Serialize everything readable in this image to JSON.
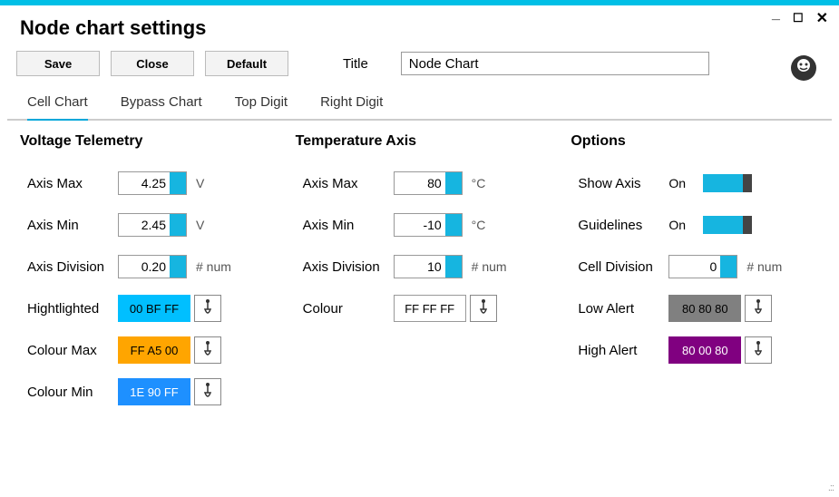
{
  "window_title": "Node chart settings",
  "toolbar": {
    "save": "Save",
    "close": "Close",
    "default": "Default",
    "title_label": "Title",
    "title_value": "Node Chart"
  },
  "tabs": {
    "cell_chart": "Cell Chart",
    "bypass_chart": "Bypass Chart",
    "top_digit": "Top Digit",
    "right_digit": "Right Digit"
  },
  "voltage": {
    "heading": "Voltage Telemetry",
    "axis_max_label": "Axis Max",
    "axis_max_value": "4.25",
    "axis_max_unit": "V",
    "axis_min_label": "Axis Min",
    "axis_min_value": "2.45",
    "axis_min_unit": "V",
    "axis_div_label": "Axis Division",
    "axis_div_value": "0.20",
    "axis_div_unit": "# num",
    "highlight_label": "Hightlighted",
    "highlight_hex": "00 BF FF",
    "highlight_color": "#00BFFF",
    "colour_max_label": "Colour Max",
    "colour_max_hex": "FF A5 00",
    "colour_max_color": "#FFA500",
    "colour_min_label": "Colour Min",
    "colour_min_hex": "1E 90 FF",
    "colour_min_color": "#1E90FF",
    "colour_min_text": "#FFFFFF"
  },
  "temperature": {
    "heading": "Temperature Axis",
    "axis_max_label": "Axis Max",
    "axis_max_value": "80",
    "axis_max_unit": "°C",
    "axis_min_label": "Axis Min",
    "axis_min_value": "-10",
    "axis_min_unit": "°C",
    "axis_div_label": "Axis Division",
    "axis_div_value": "10",
    "axis_div_unit": "# num",
    "colour_label": "Colour",
    "colour_hex": "FF FF FF",
    "colour_color": "#FFFFFF"
  },
  "options": {
    "heading": "Options",
    "show_axis_label": "Show Axis",
    "show_axis_state": "On",
    "guidelines_label": "Guidelines",
    "guidelines_state": "On",
    "cell_div_label": "Cell Division",
    "cell_div_value": "0",
    "cell_div_unit": "# num",
    "low_alert_label": "Low Alert",
    "low_alert_hex": "80 80 80",
    "low_alert_color": "#808080",
    "low_alert_text": "#000000",
    "high_alert_label": "High Alert",
    "high_alert_hex": "80 00 80",
    "high_alert_color": "#800080",
    "high_alert_text": "#FFFFFF"
  }
}
